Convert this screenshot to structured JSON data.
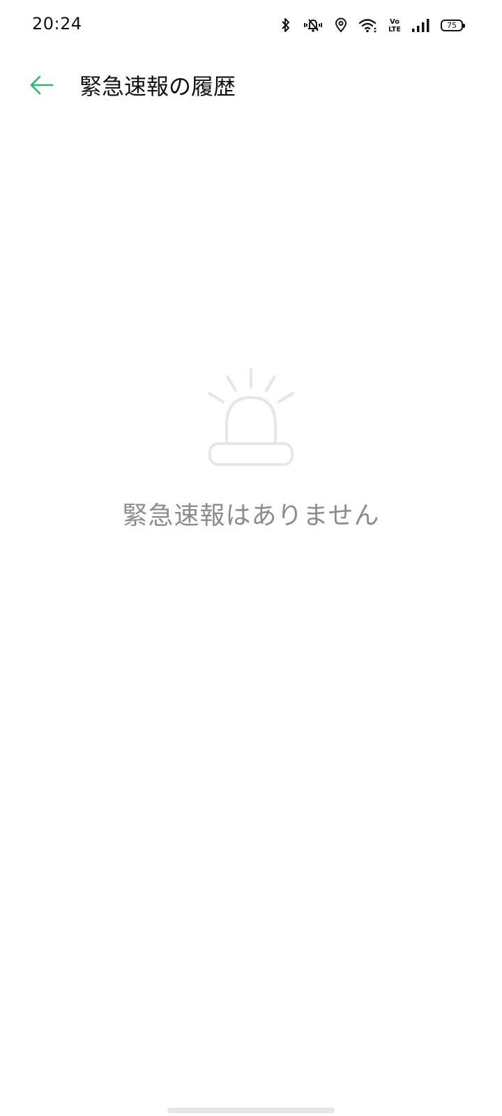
{
  "status_bar": {
    "time": "20:24",
    "battery": "75",
    "icons": [
      "bluetooth-icon",
      "vibrate-icon",
      "location-icon",
      "wifi-icon",
      "volte-icon",
      "signal-icon",
      "battery-icon"
    ]
  },
  "header": {
    "title": "緊急速報の履歴",
    "back_icon": "back-arrow-icon"
  },
  "empty_state": {
    "icon": "siren-icon",
    "message": "緊急速報はありません"
  },
  "colors": {
    "accent": "#2bb673",
    "empty_icon": "#e6e6e6",
    "empty_text": "#8c8c8c"
  }
}
